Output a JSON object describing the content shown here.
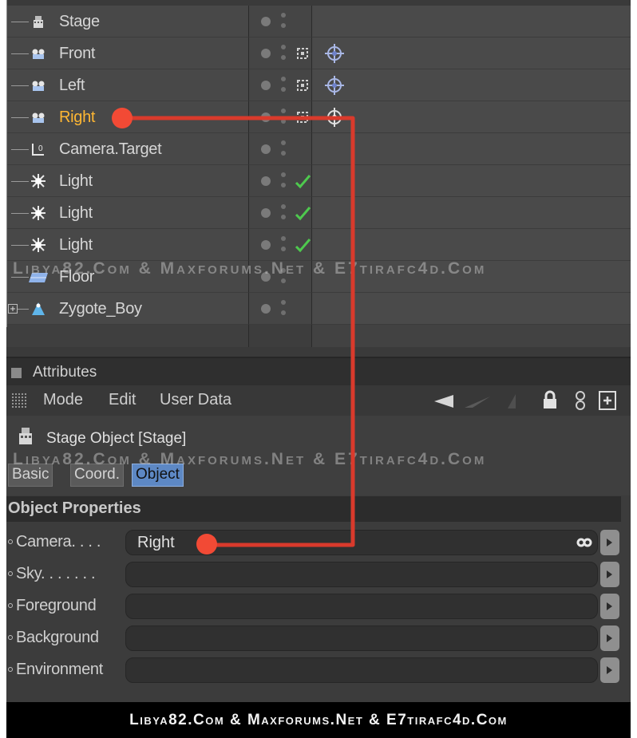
{
  "objects": [
    {
      "name": "Stage",
      "icon": "stage-icon",
      "tag": ""
    },
    {
      "name": "Front",
      "icon": "camera-icon",
      "tag": "camera"
    },
    {
      "name": "Left",
      "icon": "camera-icon",
      "tag": "camera"
    },
    {
      "name": "Right",
      "icon": "camera-icon",
      "tag": "camera",
      "selected": true
    },
    {
      "name": "Camera.Target",
      "icon": "target-null-icon",
      "tag": ""
    },
    {
      "name": "Light",
      "icon": "light-icon",
      "tag": "check"
    },
    {
      "name": "Light",
      "icon": "light-icon",
      "tag": "check"
    },
    {
      "name": "Light",
      "icon": "light-icon",
      "tag": "check"
    },
    {
      "name": "Floor",
      "icon": "floor-icon",
      "tag": ""
    },
    {
      "name": "Zygote_Boy",
      "icon": "figure-icon",
      "tag": ""
    }
  ],
  "attributes": {
    "panel_title": "Attributes",
    "menu": {
      "mode": "Mode",
      "edit": "Edit",
      "user_data": "User Data"
    },
    "object_title": "Stage Object [Stage]",
    "tabs": [
      "Basic",
      "Coord.",
      "Object"
    ],
    "active_tab": "Object",
    "section": "Object Properties",
    "properties": [
      {
        "label": "Camera. . . .",
        "value": "Right"
      },
      {
        "label": "Sky. . . . . . .",
        "value": ""
      },
      {
        "label": "Foreground",
        "value": ""
      },
      {
        "label": "Background",
        "value": ""
      },
      {
        "label": "Environment",
        "value": ""
      }
    ]
  },
  "watermark": "Libya82.Com & Maxforums.Net & E7tirafc4d.Com",
  "footer": "Libya82.Com & Maxforums.Net & E7tirafc4d.Com",
  "colors": {
    "accent": "#5d88c4",
    "selected_text": "#ffb733",
    "annotation": "#e8392a",
    "check": "#4ec94e"
  }
}
